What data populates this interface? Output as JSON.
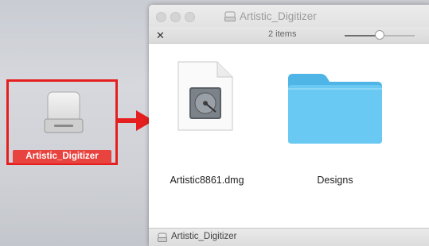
{
  "desktop": {
    "drive_label": "Artistic_Digitizer",
    "drive_icon": "external-drive-icon",
    "highlight_color": "#e51f1f"
  },
  "arrow": {
    "icon": "right-arrow-icon",
    "color": "#e51f1f"
  },
  "window": {
    "title": "Artistic_Digitizer",
    "title_icon": "drive-icon",
    "toolbar": {
      "action_icon": "tools-icon",
      "item_count": "2 items",
      "icon_size_slider_value": 0.43
    },
    "items": [
      {
        "name": "Artistic8861.dmg",
        "icon": "dmg-file-icon"
      },
      {
        "name": "Designs",
        "icon": "folder-icon",
        "color": "#5cc1ef"
      }
    ],
    "status": {
      "path_icon": "drive-icon",
      "path_label": "Artistic_Digitizer"
    }
  }
}
